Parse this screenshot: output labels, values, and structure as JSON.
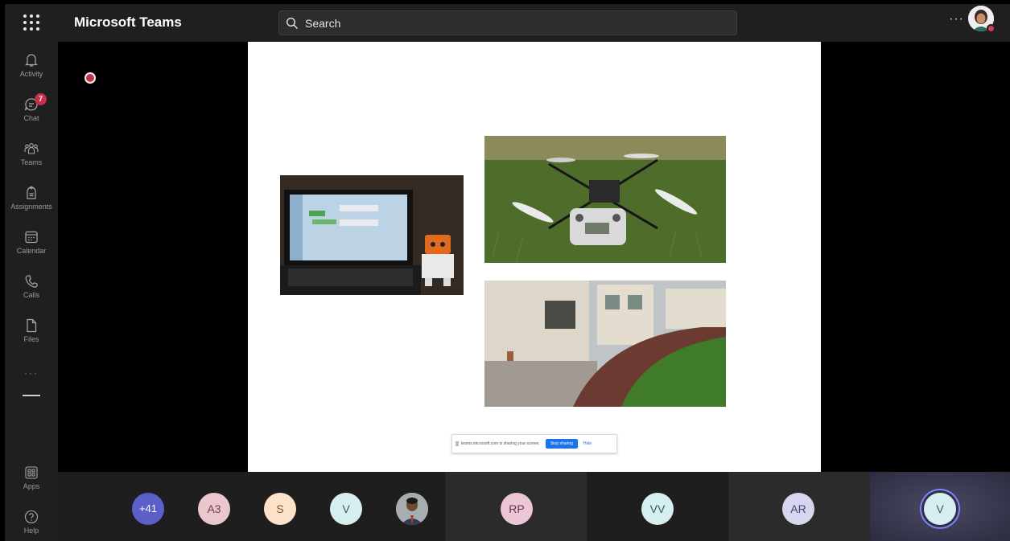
{
  "app": {
    "title": "Microsoft Teams"
  },
  "search": {
    "placeholder": "Search"
  },
  "header": {
    "more_label": "···"
  },
  "rail": {
    "items": [
      {
        "label": "Activity",
        "icon": "bell-icon"
      },
      {
        "label": "Chat",
        "icon": "chat-icon",
        "badge": "7"
      },
      {
        "label": "Teams",
        "icon": "teams-icon"
      },
      {
        "label": "Assignments",
        "icon": "assignments-icon"
      },
      {
        "label": "Calendar",
        "icon": "calendar-icon"
      },
      {
        "label": "Calls",
        "icon": "phone-icon"
      },
      {
        "label": "Files",
        "icon": "file-icon"
      }
    ],
    "more_label": "···",
    "bottom": [
      {
        "label": "Apps",
        "icon": "apps-icon"
      },
      {
        "label": "Help",
        "icon": "help-icon"
      }
    ]
  },
  "share_bar": {
    "message": "teams.microsoft.com is sharing your screen.",
    "stop_label": "Stop sharing",
    "hide_label": "Hide"
  },
  "participants": [
    {
      "initials": "+41"
    },
    {
      "initials": "A3"
    },
    {
      "initials": "S"
    },
    {
      "initials": "V"
    },
    {
      "initials": "",
      "type": "photo"
    },
    {
      "initials": "RP"
    },
    {
      "initials": "VV"
    },
    {
      "initials": "AR"
    },
    {
      "initials": "V"
    }
  ],
  "colors": {
    "accent": "#5b5fc7",
    "badge": "#c4314b",
    "stop_sharing": "#1a73e8"
  }
}
